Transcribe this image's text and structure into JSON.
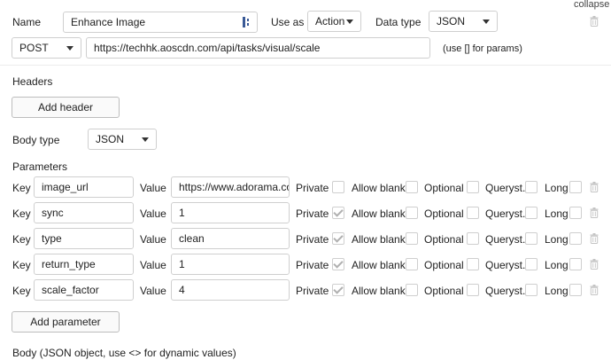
{
  "header": {
    "collapse_label": "collapse"
  },
  "call": {
    "name_label": "Name",
    "name_value": "Enhance Image",
    "use_as_label": "Use as",
    "use_as_value": "Action",
    "data_type_label": "Data type",
    "data_type_value": "JSON",
    "method_value": "POST",
    "url_value": "https://techhk.aoscdn.com/api/tasks/visual/scale",
    "url_hint": "(use [] for params)"
  },
  "headers_section": {
    "title": "Headers",
    "add_button": "Add header"
  },
  "body_type": {
    "label": "Body type",
    "value": "JSON"
  },
  "parameters": {
    "title": "Parameters",
    "key_label": "Key",
    "value_label": "Value",
    "private_label": "Private",
    "allow_blank_label": "Allow blank",
    "optional_label": "Optional",
    "queryst_label": "Queryst.",
    "long_label": "Long",
    "rows": [
      {
        "key": "image_url",
        "value": "https://www.adorama.com",
        "private": false
      },
      {
        "key": "sync",
        "value": "1",
        "private": true
      },
      {
        "key": "type",
        "value": "clean",
        "private": true
      },
      {
        "key": "return_type",
        "value": "1",
        "private": true
      },
      {
        "key": "scale_factor",
        "value": "4",
        "private": true
      }
    ],
    "add_button": "Add parameter"
  },
  "body_section": {
    "title": "Body (JSON object, use <> for dynamic values)"
  },
  "icons": {
    "trash": "trash-icon",
    "caret": "chevron-down-icon",
    "dynamic": "dynamic-data-icon",
    "check": "checkmark-icon"
  },
  "colors": {
    "border": "#cfcfcf",
    "text": "#222222",
    "icon": "#b5b5b5"
  }
}
